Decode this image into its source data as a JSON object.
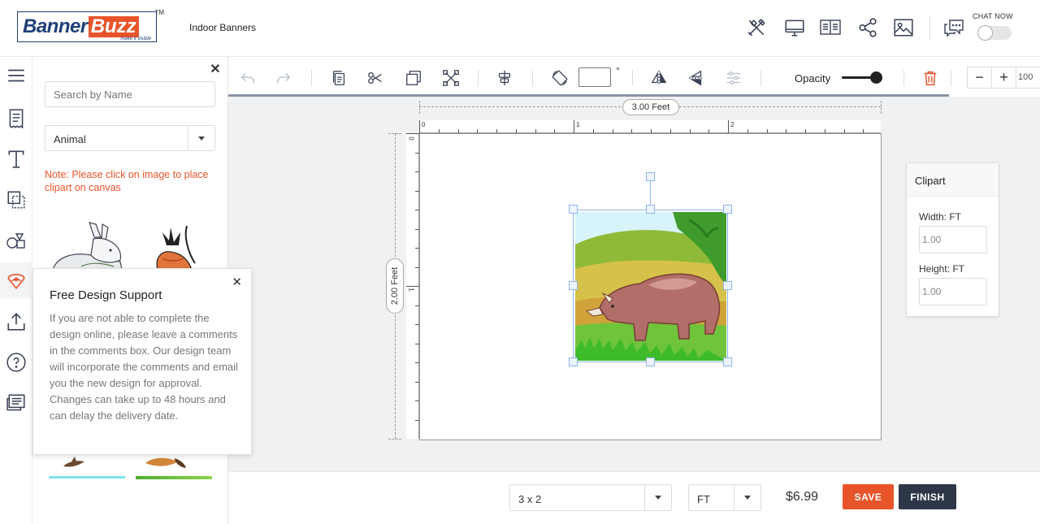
{
  "header": {
    "logo_part1": "Banner",
    "logo_part2": "Buzz",
    "logo_tagline": "make it visible",
    "logo_tm": "TM",
    "product_title": "Indoor Banners",
    "chat_label": "CHAT NOW",
    "icons": [
      "design-tools-icon",
      "desktop-preview-icon",
      "product-details-icon",
      "share-icon",
      "image-icon",
      "chat-icon"
    ]
  },
  "rail": {
    "items": [
      "menu-icon",
      "template-icon",
      "text-icon",
      "layers-icon",
      "shapes-icon",
      "clipart-icon",
      "upload-icon",
      "help-icon",
      "comments-icon"
    ],
    "active": "clipart-icon"
  },
  "clipart_panel": {
    "search_placeholder": "Search by Name",
    "category": "Animal",
    "note": "Note: Please click on image to place clipart on canvas"
  },
  "support_tip": {
    "title": "Free Design Support",
    "body": "If you are not able to complete the design online, please leave a comments in the comments box. Our design team will incorporate the comments and email you the new design for approval. Changes can take up to 48 hours and can delay the delivery date."
  },
  "toolbar": {
    "degree_symbol": "°",
    "opacity_label": "Opacity",
    "opacity_value": 1.0,
    "zoom_minus": "−",
    "zoom_plus": "+",
    "zoom_value": "100"
  },
  "canvas": {
    "width_label": "3.00 Feet",
    "height_label": "2.00 Feet",
    "ruler_top": [
      "0",
      "1",
      "2"
    ],
    "ruler_left": [
      "0",
      "1"
    ]
  },
  "clipart_props": {
    "title": "Clipart",
    "width_label": "Width: FT",
    "width_value": "1.00",
    "height_label": "Height: FT",
    "height_value": "1.00"
  },
  "footer": {
    "size": "3 x 2",
    "unit": "FT",
    "price": "$6.99",
    "save_label": "SAVE",
    "finish_label": "FINISH"
  },
  "colors": {
    "accent": "#e8542a",
    "dark": "#2d3748",
    "brand_blue": "#1f3f7a"
  }
}
